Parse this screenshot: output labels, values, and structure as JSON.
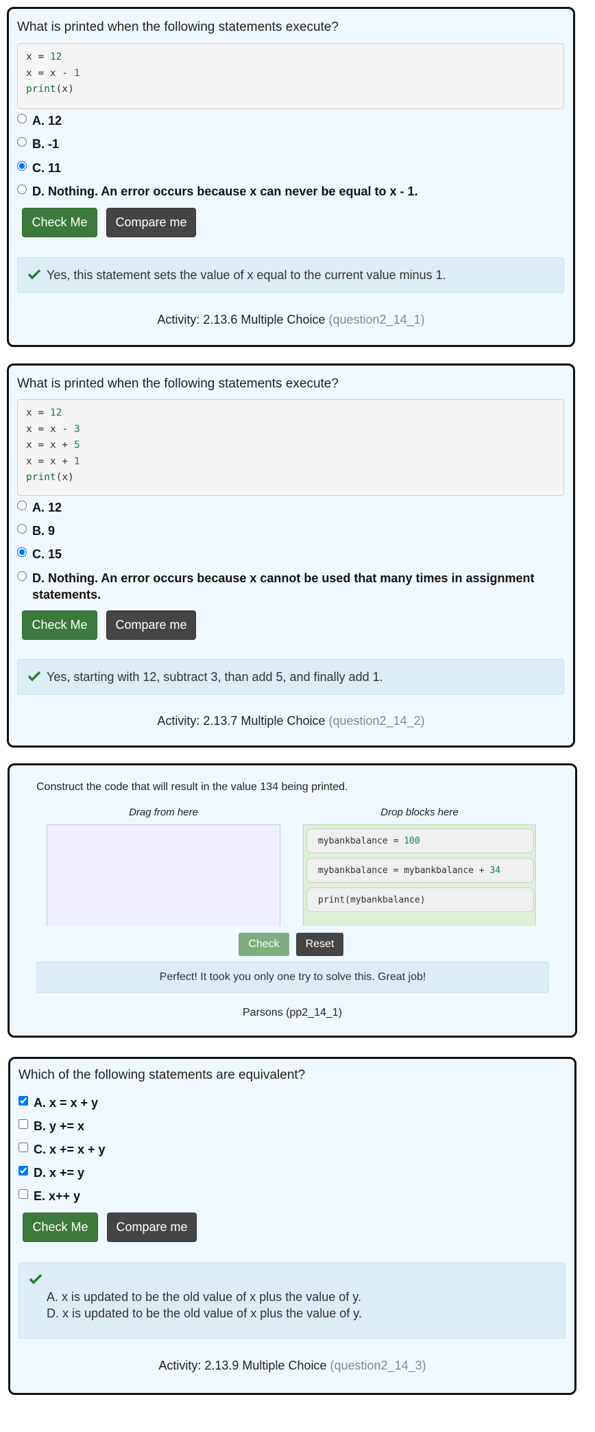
{
  "q1": {
    "question": "What is printed when the following statements execute?",
    "code": [
      {
        "a": "x = ",
        "n": "12",
        "b": ""
      },
      {
        "a": "x = x - ",
        "n": "1",
        "b": ""
      },
      {
        "a": "print",
        "n": "",
        "b": "(x)"
      }
    ],
    "options": [
      "A. 12",
      "B. -1",
      "C. 11",
      "D. Nothing. An error occurs because x can never be equal to x - 1."
    ],
    "selected": 2,
    "check_label": "Check Me",
    "compare_label": "Compare me",
    "feedback": "Yes, this statement sets the value of x equal to the current value minus 1.",
    "activity": "Activity: 2.13.6 Multiple Choice",
    "activity_id": "(question2_14_1)"
  },
  "q2": {
    "question": "What is printed when the following statements execute?",
    "code": [
      {
        "a": "x = ",
        "n": "12",
        "b": ""
      },
      {
        "a": "x = x - ",
        "n": "3",
        "b": ""
      },
      {
        "a": "x = x + ",
        "n": "5",
        "b": ""
      },
      {
        "a": "x = x + ",
        "n": "1",
        "b": ""
      },
      {
        "a": "print",
        "n": "",
        "b": "(x)"
      }
    ],
    "options": [
      "A. 12",
      "B. 9",
      "C. 15",
      "D. Nothing. An error occurs because x cannot be used that many times in assignment statements."
    ],
    "selected": 2,
    "check_label": "Check Me",
    "compare_label": "Compare me",
    "feedback": "Yes, starting with 12, subtract 3, than add 5, and finally add 1.",
    "activity": "Activity: 2.13.7 Multiple Choice",
    "activity_id": "(question2_14_2)"
  },
  "parsons": {
    "prompt": "Construct the code that will result in the value 134 being printed.",
    "source_heading": "Drag from here",
    "answer_heading": "Drop blocks here",
    "blocks": [
      {
        "a": "mybankbalance = ",
        "n": "100",
        "b": ""
      },
      {
        "a": "mybankbalance = mybankbalance + ",
        "n": "34",
        "b": ""
      },
      {
        "a": "print(mybankbalance)",
        "n": "",
        "b": ""
      }
    ],
    "check_label": "Check",
    "reset_label": "Reset",
    "feedback": "Perfect! It took you only one try to solve this. Great job!",
    "footer": "Parsons (pp2_14_1)"
  },
  "q3": {
    "question": "Which of the following statements are equivalent?",
    "options": [
      "A. x = x + y",
      "B. y += x",
      "C. x += x + y",
      "D. x += y",
      "E. x++ y"
    ],
    "checked": [
      true,
      false,
      false,
      true,
      false
    ],
    "check_label": "Check Me",
    "compare_label": "Compare me",
    "feedback_lines": [
      "A. x is updated to be the old value of x plus the value of y.",
      "D. x is updated to be the old value of x plus the value of y."
    ],
    "activity": "Activity: 2.13.9 Multiple Choice",
    "activity_id": "(question2_14_3)"
  },
  "colors": {
    "check_green": "#3c7a3c",
    "compare_dark": "#454545",
    "feedback_bg": "#dcedf5",
    "card_bg": "#f0f8ff"
  }
}
